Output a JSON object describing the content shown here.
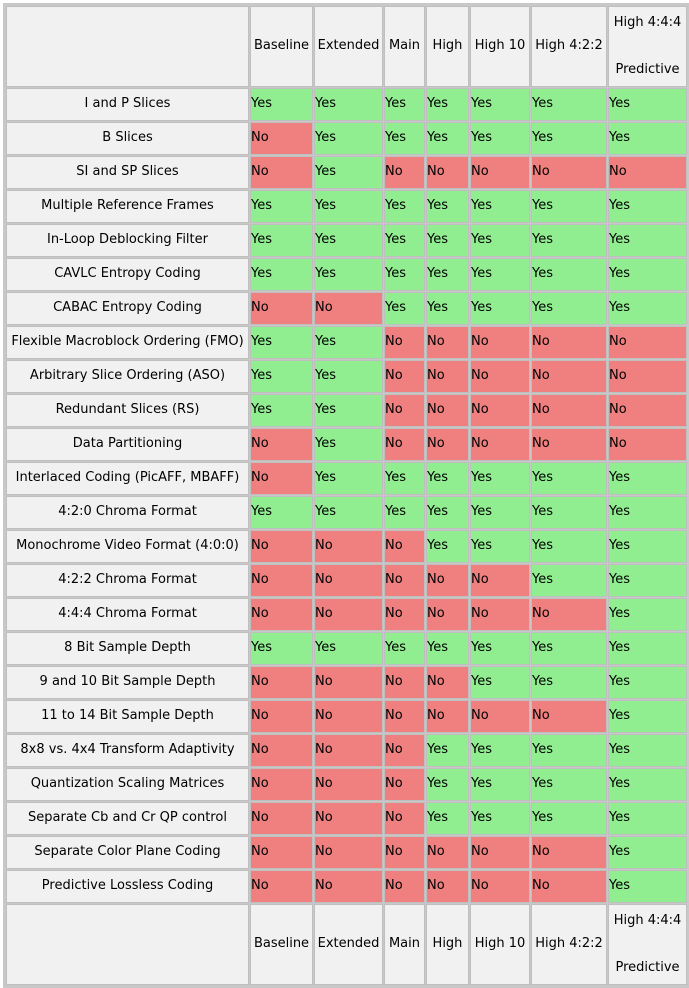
{
  "table": {
    "corner_label": "",
    "profiles": [
      {
        "label": "Baseline",
        "line1": "Baseline",
        "line2": ""
      },
      {
        "label": "Extended",
        "line1": "Extended",
        "line2": ""
      },
      {
        "label": "Main",
        "line1": "Main",
        "line2": ""
      },
      {
        "label": "High",
        "line1": "High",
        "line2": ""
      },
      {
        "label": "High 10",
        "line1": "High 10",
        "line2": ""
      },
      {
        "label": "High 4:2:2",
        "line1": "High 4:2:2",
        "line2": ""
      },
      {
        "label": "High 4:4:4 Predictive",
        "line1": "High 4:4:4",
        "line2": "Predictive"
      }
    ],
    "yes_label": "Yes",
    "no_label": "No",
    "colors": {
      "yes_background": "#90EE90",
      "no_background": "#F08080",
      "header_background": "#F1F1F1",
      "border": "#BFBFBF",
      "outer_border": "#C8C8C8",
      "text": "#000000"
    },
    "rows": [
      {
        "feature": "I and P Slices",
        "values": [
          "Yes",
          "Yes",
          "Yes",
          "Yes",
          "Yes",
          "Yes",
          "Yes"
        ]
      },
      {
        "feature": "B Slices",
        "values": [
          "No",
          "Yes",
          "Yes",
          "Yes",
          "Yes",
          "Yes",
          "Yes"
        ]
      },
      {
        "feature": "SI and SP Slices",
        "values": [
          "No",
          "Yes",
          "No",
          "No",
          "No",
          "No",
          "No"
        ]
      },
      {
        "feature": "Multiple Reference Frames",
        "values": [
          "Yes",
          "Yes",
          "Yes",
          "Yes",
          "Yes",
          "Yes",
          "Yes"
        ]
      },
      {
        "feature": "In-Loop Deblocking Filter",
        "values": [
          "Yes",
          "Yes",
          "Yes",
          "Yes",
          "Yes",
          "Yes",
          "Yes"
        ]
      },
      {
        "feature": "CAVLC Entropy Coding",
        "values": [
          "Yes",
          "Yes",
          "Yes",
          "Yes",
          "Yes",
          "Yes",
          "Yes"
        ]
      },
      {
        "feature": "CABAC Entropy Coding",
        "values": [
          "No",
          "No",
          "Yes",
          "Yes",
          "Yes",
          "Yes",
          "Yes"
        ]
      },
      {
        "feature": "Flexible Macroblock Ordering (FMO)",
        "values": [
          "Yes",
          "Yes",
          "No",
          "No",
          "No",
          "No",
          "No"
        ]
      },
      {
        "feature": "Arbitrary Slice Ordering (ASO)",
        "values": [
          "Yes",
          "Yes",
          "No",
          "No",
          "No",
          "No",
          "No"
        ]
      },
      {
        "feature": "Redundant Slices (RS)",
        "values": [
          "Yes",
          "Yes",
          "No",
          "No",
          "No",
          "No",
          "No"
        ]
      },
      {
        "feature": "Data Partitioning",
        "values": [
          "No",
          "Yes",
          "No",
          "No",
          "No",
          "No",
          "No"
        ]
      },
      {
        "feature": "Interlaced Coding (PicAFF, MBAFF)",
        "values": [
          "No",
          "Yes",
          "Yes",
          "Yes",
          "Yes",
          "Yes",
          "Yes"
        ]
      },
      {
        "feature": "4:2:0 Chroma Format",
        "values": [
          "Yes",
          "Yes",
          "Yes",
          "Yes",
          "Yes",
          "Yes",
          "Yes"
        ]
      },
      {
        "feature": "Monochrome Video Format (4:0:0)",
        "values": [
          "No",
          "No",
          "No",
          "Yes",
          "Yes",
          "Yes",
          "Yes"
        ]
      },
      {
        "feature": "4:2:2 Chroma Format",
        "values": [
          "No",
          "No",
          "No",
          "No",
          "No",
          "Yes",
          "Yes"
        ]
      },
      {
        "feature": "4:4:4 Chroma Format",
        "values": [
          "No",
          "No",
          "No",
          "No",
          "No",
          "No",
          "Yes"
        ]
      },
      {
        "feature": "8 Bit Sample Depth",
        "values": [
          "Yes",
          "Yes",
          "Yes",
          "Yes",
          "Yes",
          "Yes",
          "Yes"
        ]
      },
      {
        "feature": "9 and 10 Bit Sample Depth",
        "values": [
          "No",
          "No",
          "No",
          "No",
          "Yes",
          "Yes",
          "Yes"
        ]
      },
      {
        "feature": "11 to 14 Bit Sample Depth",
        "values": [
          "No",
          "No",
          "No",
          "No",
          "No",
          "No",
          "Yes"
        ]
      },
      {
        "feature": "8x8 vs. 4x4 Transform Adaptivity",
        "values": [
          "No",
          "No",
          "No",
          "Yes",
          "Yes",
          "Yes",
          "Yes"
        ]
      },
      {
        "feature": "Quantization Scaling Matrices",
        "values": [
          "No",
          "No",
          "No",
          "Yes",
          "Yes",
          "Yes",
          "Yes"
        ]
      },
      {
        "feature": "Separate Cb and Cr QP control",
        "values": [
          "No",
          "No",
          "No",
          "Yes",
          "Yes",
          "Yes",
          "Yes"
        ]
      },
      {
        "feature": "Separate Color Plane Coding",
        "values": [
          "No",
          "No",
          "No",
          "No",
          "No",
          "No",
          "Yes"
        ]
      },
      {
        "feature": "Predictive Lossless Coding",
        "values": [
          "No",
          "No",
          "No",
          "No",
          "No",
          "No",
          "Yes"
        ]
      }
    ]
  }
}
